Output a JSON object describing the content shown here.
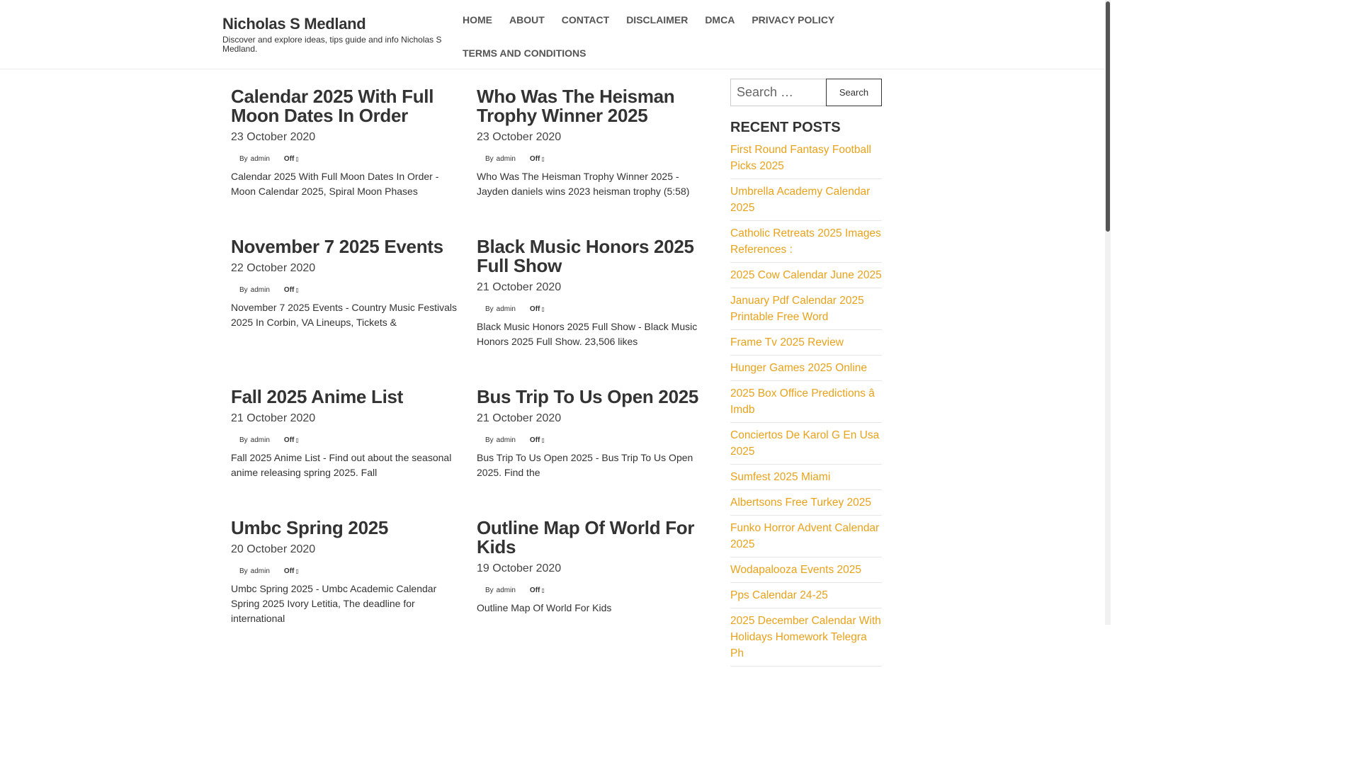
{
  "site": {
    "title": "Nicholas S Medland",
    "description": "Discover and explore ideas, tips guide and info Nicholas S Medland."
  },
  "nav": {
    "items": [
      "HOME",
      "ABOUT",
      "CONTACT",
      "DISCLAIMER",
      "DMCA",
      "PRIVACY POLICY",
      "TERMS AND CONDITIONS"
    ]
  },
  "posts": [
    {
      "title": "Calendar 2025 With Full Moon Dates In Order",
      "date": "23 October 2020",
      "by": "By",
      "author": "admin",
      "comments": "Off",
      "excerpt": "Calendar 2025 With Full Moon Dates In Order - Moon Calendar 2025, Spiral Moon Phases"
    },
    {
      "title": "Who Was The Heisman Trophy Winner 2025",
      "date": "23 October 2020",
      "by": "By",
      "author": "admin",
      "comments": "Off",
      "excerpt": "Who Was The Heisman Trophy Winner 2025 - Jayden daniels wins 2023 heisman trophy (5:58)"
    },
    {
      "title": "November 7 2025 Events",
      "date": "22 October 2020",
      "by": "By",
      "author": "admin",
      "comments": "Off",
      "excerpt": "November 7 2025 Events - Country Music Festivals 2025 In Corbin, VA Lineups, Tickets &"
    },
    {
      "title": "Black Music Honors 2025 Full Show",
      "date": "21 October 2020",
      "by": "By",
      "author": "admin",
      "comments": "Off",
      "excerpt": "Black Music Honors 2025 Full Show - Black Music Honors 2025 Full Show. 23,506 likes"
    },
    {
      "title": "Fall 2025 Anime List",
      "date": "21 October 2020",
      "by": "By",
      "author": "admin",
      "comments": "Off",
      "excerpt": "Fall 2025 Anime List - Find out about the seasonal anime releasing spring 2025. Fall"
    },
    {
      "title": "Bus Trip To Us Open 2025",
      "date": "21 October 2020",
      "by": "By",
      "author": "admin",
      "comments": "Off",
      "excerpt": "Bus Trip To Us Open 2025 - Bus Trip To Us Open 2025. Find the"
    },
    {
      "title": "Umbc Spring 2025",
      "date": "20 October 2020",
      "by": "By",
      "author": "admin",
      "comments": "Off",
      "excerpt": "Umbc Spring 2025 - Umbc Academic Calendar Spring 2025 Ivory Letitia, The deadline for international"
    },
    {
      "title": "Outline Map Of World For Kids",
      "date": "19 October 2020",
      "by": "By",
      "author": "admin",
      "comments": "Off",
      "excerpt": "Outline Map Of World For Kids"
    }
  ],
  "search": {
    "placeholder": "Search …",
    "button_label": "Search"
  },
  "recent_posts": {
    "heading": "RECENT POSTS",
    "link_color": "#e8a21a",
    "items": [
      "First Round Fantasy Football Picks 2025",
      "Umbrella Academy Calendar 2025",
      "Catholic Retreats 2025 Images References :",
      "2025 Cow Calendar June 2025",
      "January Pdf Calendar 2025 Printable Free Word",
      "Frame Tv 2025 Review",
      "Hunger Games 2025 Online",
      "2025 Box Office Predictions â Imdb",
      "Conciertos De Karol G En Usa 2025",
      "Sumfest 2025 Miami",
      "Albertsons Free Turkey 2025",
      "Funko Horror Advent Calendar 2025",
      "Wodapalooza Events 2025",
      "Pps Calendar 24-25",
      "2025 December Calendar With Holidays Homework Telegra Ph"
    ]
  }
}
